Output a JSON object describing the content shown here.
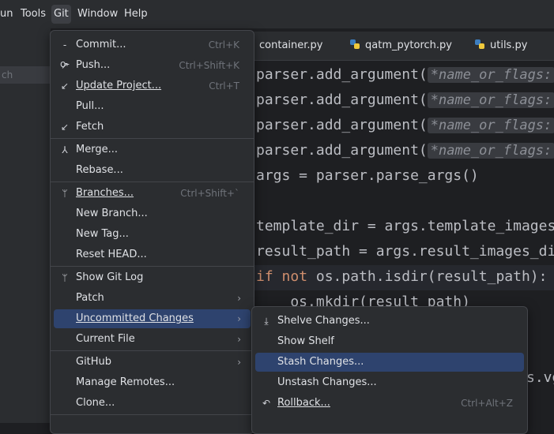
{
  "menubar": {
    "items": [
      {
        "label": "un"
      },
      {
        "label": "Tools"
      },
      {
        "label": "Git"
      },
      {
        "label": "Window"
      },
      {
        "label": "Help"
      }
    ]
  },
  "left_panel": {
    "selected_text": "ch"
  },
  "tabs": [
    {
      "label": "container.py"
    },
    {
      "label": "qatm_pytorch.py"
    },
    {
      "label": "utils.py"
    }
  ],
  "code": {
    "lines": [
      {
        "pre": "parser.add_argument(",
        "hint": "*name_or_flags:",
        "post": " '"
      },
      {
        "pre": "parser.add_argument(",
        "hint": "*name_or_flags:",
        "post": " '"
      },
      {
        "pre": "parser.add_argument(",
        "hint": "*name_or_flags:",
        "post": " '"
      },
      {
        "pre": "parser.add_argument(",
        "hint": "*name_or_flags:",
        "post": " '"
      },
      {
        "text": "args = parser.parse_args()"
      },
      {
        "text": ""
      },
      {
        "text": "template_dir = args.template_images"
      },
      {
        "text": "result_path = args.result_images_di"
      },
      {
        "kw1": "if",
        "kw2": "not",
        "rest": " os.path.isdir(result_path):"
      },
      {
        "text": "    os.mkdir(result_path)"
      },
      {
        "text": "s.vg"
      }
    ]
  },
  "git_menu": {
    "items": [
      {
        "icon": "commit-icon",
        "glyph": "-o-",
        "label": "Commit...",
        "shortcut": "Ctrl+K"
      },
      {
        "icon": "push-icon",
        "glyph": "↗",
        "label": "Push...",
        "shortcut": "Ctrl+Shift+K"
      },
      {
        "icon": "update-icon",
        "glyph": "↙",
        "label": "Update Project...",
        "shortcut": "Ctrl+T"
      },
      {
        "icon": "",
        "glyph": "",
        "label": "Pull...",
        "shortcut": ""
      },
      {
        "icon": "fetch-icon",
        "glyph": "↙",
        "label": "Fetch",
        "shortcut": ""
      },
      {
        "icon": "merge-icon",
        "glyph": "⅄",
        "label": "Merge...",
        "shortcut": ""
      },
      {
        "icon": "",
        "glyph": "",
        "label": "Rebase...",
        "shortcut": ""
      },
      {
        "icon": "branches-icon",
        "glyph": "ᛘ",
        "label": "Branches...",
        "shortcut": "Ctrl+Shift+`"
      },
      {
        "icon": "",
        "glyph": "",
        "label": "New Branch...",
        "shortcut": ""
      },
      {
        "icon": "",
        "glyph": "",
        "label": "New Tag...",
        "shortcut": ""
      },
      {
        "icon": "",
        "glyph": "",
        "label": "Reset HEAD...",
        "shortcut": ""
      },
      {
        "icon": "git-log-icon",
        "glyph": "ᛘ",
        "label": "Show Git Log",
        "shortcut": ""
      },
      {
        "icon": "",
        "glyph": "",
        "label": "Patch",
        "shortcut": ""
      },
      {
        "icon": "",
        "glyph": "",
        "label": "Uncommitted Changes",
        "shortcut": ""
      },
      {
        "icon": "",
        "glyph": "",
        "label": "Current File",
        "shortcut": ""
      },
      {
        "icon": "",
        "glyph": "",
        "label": "GitHub",
        "shortcut": ""
      },
      {
        "icon": "",
        "glyph": "",
        "label": "Manage Remotes...",
        "shortcut": ""
      },
      {
        "icon": "",
        "glyph": "",
        "label": "Clone...",
        "shortcut": ""
      }
    ]
  },
  "submenu": {
    "items": [
      {
        "icon": "shelve-icon",
        "glyph": "⤓",
        "label": "Shelve Changes...",
        "shortcut": ""
      },
      {
        "icon": "",
        "glyph": "",
        "label": "Show Shelf",
        "shortcut": ""
      },
      {
        "icon": "",
        "glyph": "",
        "label": "Stash Changes...",
        "shortcut": ""
      },
      {
        "icon": "",
        "glyph": "",
        "label": "Unstash Changes...",
        "shortcut": ""
      },
      {
        "icon": "rollback-icon",
        "glyph": "↶",
        "label": "Rollback...",
        "shortcut": "Ctrl+Alt+Z"
      }
    ]
  },
  "colors": {
    "accent": "#2e436e",
    "menu_bg": "#2b2d30",
    "keyword": "#cf8e6d"
  }
}
